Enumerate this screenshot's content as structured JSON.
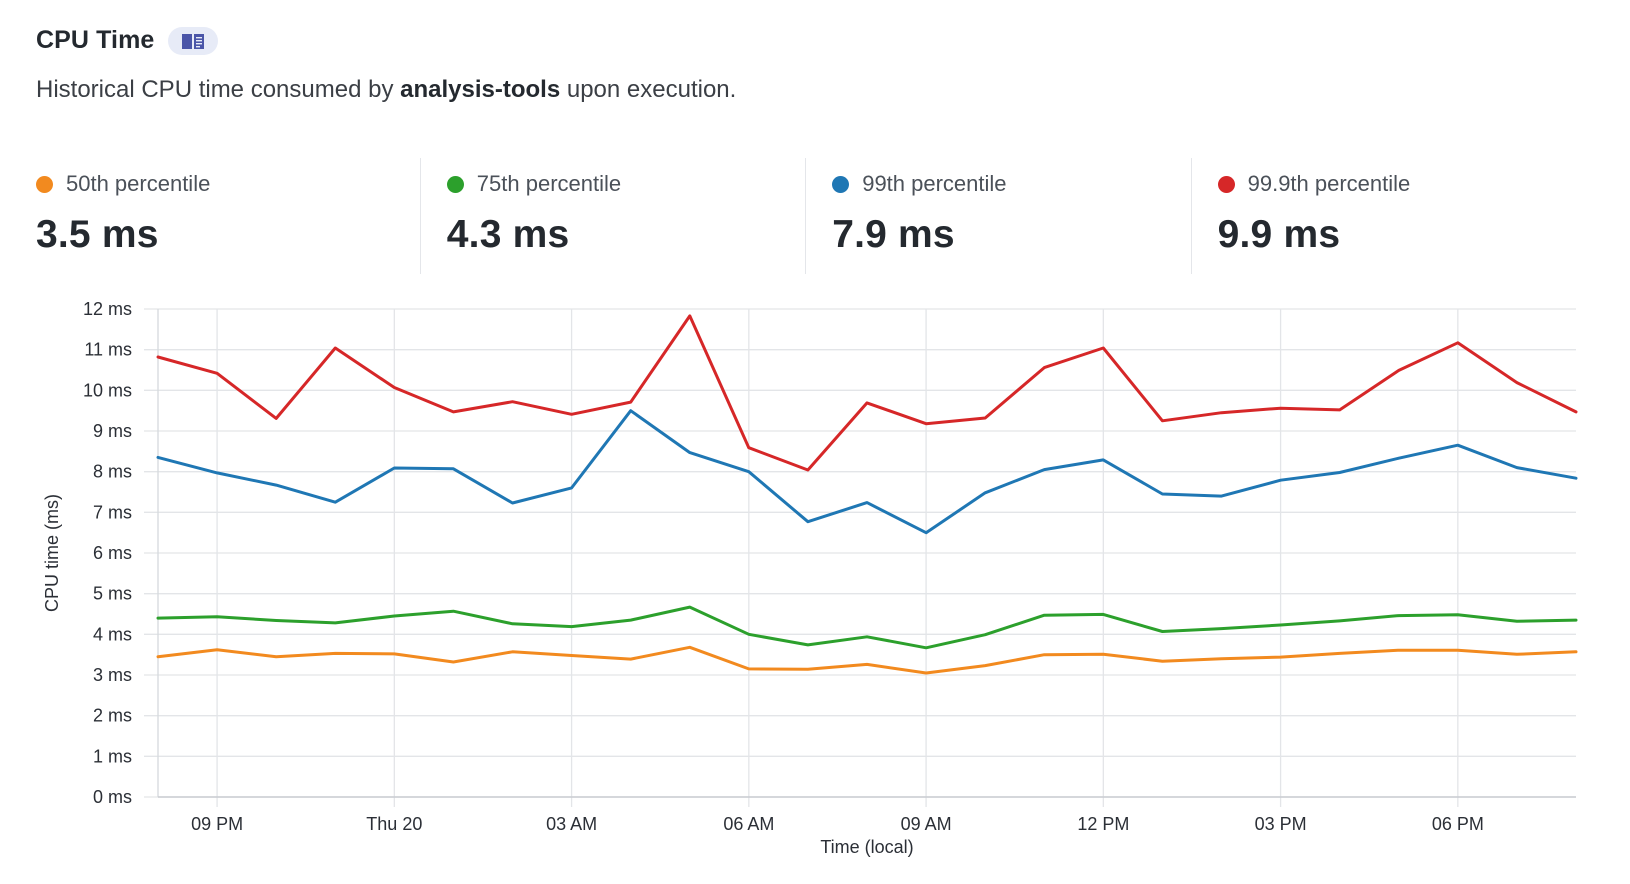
{
  "header": {
    "title": "CPU Time",
    "icon": "book-icon"
  },
  "subtitle": {
    "prefix": "Historical CPU time consumed by ",
    "tool": "analysis-tools",
    "suffix": " upon execution."
  },
  "stats": [
    {
      "label": "50th percentile",
      "value": "3.5 ms",
      "color": "#f28a1f"
    },
    {
      "label": "75th percentile",
      "value": "4.3 ms",
      "color": "#2ca02c"
    },
    {
      "label": "99th percentile",
      "value": "7.9 ms",
      "color": "#1f77b4"
    },
    {
      "label": "99.9th percentile",
      "value": "9.9 ms",
      "color": "#d62728"
    }
  ],
  "chart_data": {
    "type": "line",
    "xlabel": "Time (local)",
    "ylabel": "CPU time (ms)",
    "ylim": [
      0,
      12
    ],
    "y_ticks": [
      0,
      1,
      2,
      3,
      4,
      5,
      6,
      7,
      8,
      9,
      10,
      11,
      12
    ],
    "y_tick_suffix": " ms",
    "x_tick_labels": [
      "09 PM",
      "Thu 20",
      "03 AM",
      "06 AM",
      "09 AM",
      "12 PM",
      "03 PM",
      "06 PM"
    ],
    "x_tick_hours": [
      21,
      24,
      27,
      30,
      33,
      36,
      39,
      42
    ],
    "x_range_hours": [
      20,
      44
    ],
    "x_hours": [
      20,
      21,
      22,
      23,
      24,
      25,
      26,
      27,
      28,
      29,
      30,
      31,
      32,
      33,
      34,
      35,
      36,
      37,
      38,
      39,
      40,
      41,
      42,
      43,
      44
    ],
    "grid": true,
    "series": [
      {
        "name": "50th percentile",
        "color": "#f28a1f",
        "values": [
          3.45,
          3.62,
          3.45,
          3.53,
          3.52,
          3.32,
          3.57,
          3.48,
          3.39,
          3.68,
          3.15,
          3.14,
          3.26,
          3.05,
          3.23,
          3.5,
          3.51,
          3.34,
          3.4,
          3.44,
          3.53,
          3.61,
          3.61,
          3.51,
          3.57
        ]
      },
      {
        "name": "75th percentile",
        "color": "#2ca02c",
        "values": [
          4.4,
          4.43,
          4.34,
          4.28,
          4.45,
          4.57,
          4.26,
          4.19,
          4.35,
          4.67,
          4.0,
          3.74,
          3.94,
          3.67,
          3.99,
          4.47,
          4.49,
          4.07,
          4.14,
          4.23,
          4.33,
          4.46,
          4.48,
          4.32,
          4.35
        ]
      },
      {
        "name": "99th percentile",
        "color": "#1f77b4",
        "values": [
          8.35,
          7.97,
          7.67,
          7.25,
          8.09,
          8.07,
          7.23,
          7.6,
          9.5,
          8.47,
          8.0,
          6.77,
          7.24,
          6.5,
          7.48,
          8.05,
          8.29,
          7.45,
          7.4,
          7.79,
          7.98,
          8.33,
          8.65,
          8.1,
          7.84
        ]
      },
      {
        "name": "99.9th percentile",
        "color": "#d62728",
        "values": [
          10.82,
          10.42,
          9.31,
          11.04,
          10.07,
          9.47,
          9.72,
          9.41,
          9.71,
          11.83,
          8.59,
          8.04,
          9.69,
          9.18,
          9.32,
          10.56,
          11.04,
          9.25,
          9.45,
          9.56,
          9.52,
          10.49,
          11.17,
          10.19,
          9.47
        ]
      }
    ]
  }
}
